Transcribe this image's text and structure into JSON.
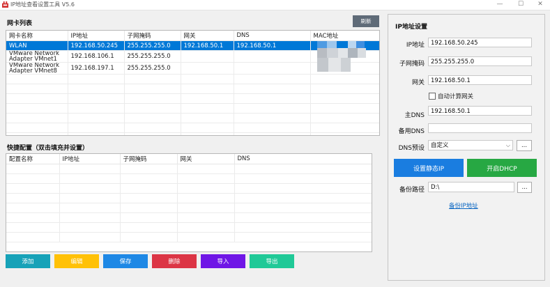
{
  "window": {
    "title": "IP地址查看设置工具 V5.6"
  },
  "adapters": {
    "section_title": "网卡列表",
    "refresh_label": "刷新",
    "columns": [
      "网卡名称",
      "IP地址",
      "子网掩码",
      "网关",
      "DNS",
      "MAC地址"
    ],
    "rows": [
      {
        "name": "WLAN",
        "ip": "192.168.50.245",
        "mask": "255.255.255.0",
        "gateway": "192.168.50.1",
        "dns": "192.168.50.1"
      },
      {
        "name": "VMware Network Adapter VMnet1",
        "ip": "192.168.106.1",
        "mask": "255.255.255.0",
        "gateway": "",
        "dns": ""
      },
      {
        "name": "VMware Network Adapter VMnet8",
        "ip": "192.168.197.1",
        "mask": "255.255.255.0",
        "gateway": "",
        "dns": ""
      }
    ]
  },
  "quick": {
    "section_title": "快捷配置（双击填充并设置）",
    "columns": [
      "配置名称",
      "IP地址",
      "子网掩码",
      "网关",
      "DNS"
    ],
    "buttons": {
      "add": "添加",
      "edit": "编辑",
      "save": "保存",
      "delete": "删除",
      "import": "导入",
      "export": "导出"
    }
  },
  "settings": {
    "title": "IP地址设置",
    "ip_label": "IP地址",
    "ip_value": "192.168.50.245",
    "mask_label": "子网掩码",
    "mask_value": "255.255.255.0",
    "gateway_label": "网关",
    "gateway_value": "192.168.50.1",
    "auto_gateway_label": "自动计算网关",
    "dns1_label": "主DNS",
    "dns1_value": "192.168.50.1",
    "dns2_label": "备用DNS",
    "dns2_value": "",
    "dns_preset_label": "DNS预设",
    "dns_preset_value": "自定义",
    "browse_label": "...",
    "static_btn": "设置静态IP",
    "dhcp_btn": "开启DHCP",
    "backup_path_label": "备份路径",
    "backup_path_value": "D:\\",
    "backup_link": "备份IP地址"
  },
  "colors": {
    "static": "#1a7de0",
    "dhcp": "#27a843",
    "add": "#17a2b8",
    "edit": "#ffc107",
    "save": "#1e88e5",
    "delete": "#dc3545",
    "import": "#6f16e6",
    "export": "#20c997",
    "selection": "#0078d7"
  }
}
